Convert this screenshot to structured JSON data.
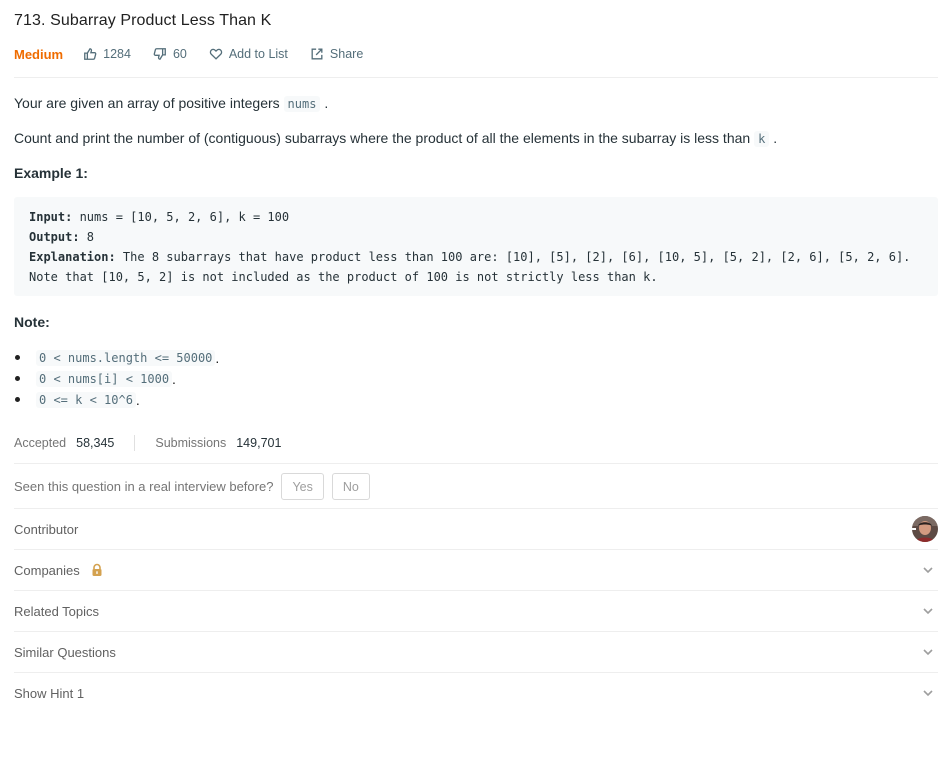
{
  "problem": {
    "title": "713. Subarray Product Less Than K",
    "difficulty": "Medium",
    "likes": "1284",
    "dislikes": "60",
    "add_to_list": "Add to List",
    "share": "Share"
  },
  "description": {
    "p1_text": "Your are given an array of positive integers ",
    "p1_code": "nums",
    "p1_end": ".",
    "p2_text": "Count and print the number of (contiguous) subarrays where the product of all the elements in the subarray is less than ",
    "p2_code": "k",
    "p2_end": ".",
    "example_heading": "Example 1:",
    "example": {
      "input_label": "Input:",
      "input_value": " nums = [10, 5, 2, 6], k = 100",
      "output_label": "Output:",
      "output_value": " 8",
      "explanation_label": "Explanation:",
      "explanation_value": " The 8 subarrays that have product less than 100 are: [10], [5], [2], [6], [10, 5], [5, 2], [2, 6], [5, 2, 6].",
      "explanation_line2": "Note that [10, 5, 2] is not included as the product of 100 is not strictly less than k."
    },
    "note_heading": "Note:",
    "notes": [
      {
        "code": "0 < nums.length <= 50000",
        "end": "."
      },
      {
        "code": "0 < nums[i] < 1000",
        "end": "."
      },
      {
        "code": "0 <= k < 10^6",
        "end": "."
      }
    ]
  },
  "stats": {
    "accepted_label": "Accepted",
    "accepted_value": "58,345",
    "submissions_label": "Submissions",
    "submissions_value": "149,701"
  },
  "interview": {
    "question": "Seen this question in a real interview before?",
    "yes": "Yes",
    "no": "No"
  },
  "sections": {
    "contributor": "Contributor",
    "companies": "Companies",
    "related_topics": "Related Topics",
    "similar_questions": "Similar Questions",
    "show_hint": "Show Hint 1"
  },
  "colors": {
    "difficulty_medium": "#ef6c00",
    "lock": "#d4a250"
  },
  "icons": [
    "thumbs-up-icon",
    "thumbs-down-icon",
    "heart-icon",
    "share-icon",
    "lock-icon",
    "chevron-down-icon"
  ]
}
